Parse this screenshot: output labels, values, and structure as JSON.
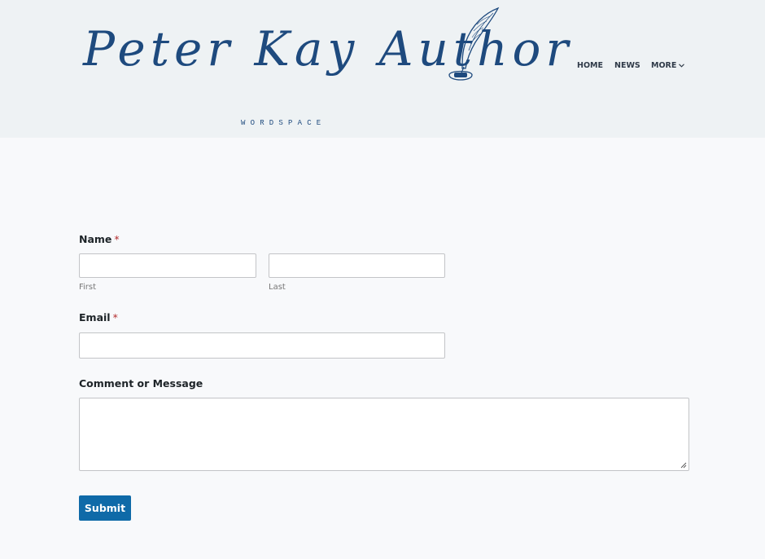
{
  "site": {
    "logo_text": "Peter Kay Author",
    "tagline": "WORDSPACE"
  },
  "nav": {
    "home": "HOME",
    "news": "NEWS",
    "more": "MORE"
  },
  "form": {
    "name_label": "Name",
    "required_mark": "*",
    "first_sublabel": "First",
    "last_sublabel": "Last",
    "first_value": "",
    "last_value": "",
    "email_label": "Email",
    "email_value": "",
    "message_label": "Comment or Message",
    "message_value": "",
    "submit_label": "Submit"
  },
  "icons": {
    "logo_quill": "quill-inkwell-icon",
    "more_chevron": "chevron-down-icon",
    "textarea_resize": "resize-handle-icon"
  },
  "colors": {
    "brand_blue": "#1e4a7e",
    "button_blue": "#0f6aa8",
    "required_red": "#b32d2e",
    "header_bg": "#eef2f4",
    "page_bg": "#f8f9fb"
  }
}
